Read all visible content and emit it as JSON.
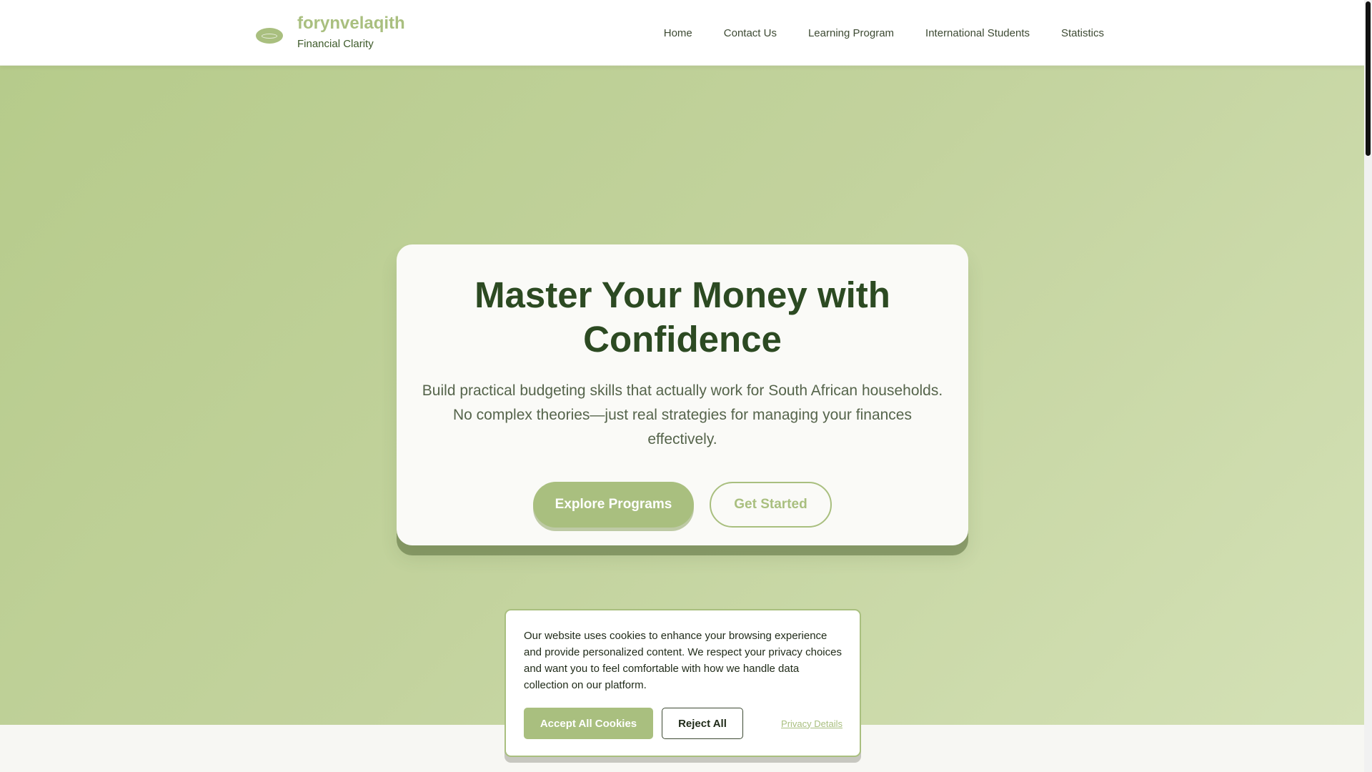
{
  "brand": {
    "name": "forynvelaqith",
    "tagline": "Financial Clarity"
  },
  "nav": {
    "items": [
      {
        "label": "Home"
      },
      {
        "label": "Contact Us"
      },
      {
        "label": "Learning Program"
      },
      {
        "label": "International Students"
      },
      {
        "label": "Statistics"
      }
    ]
  },
  "hero": {
    "title": "Master Your Money with Confidence",
    "subtitle": "Build practical budgeting skills that actually work for South African households. No complex theories—just real strategies for managing your finances effectively.",
    "primary_cta": "Explore Programs",
    "secondary_cta": "Get Started"
  },
  "cookie": {
    "message": "Our website uses cookies to enhance your browsing experience and provide personalized content. We respect your privacy choices and want you to feel comfortable with how we handle data collection on our platform.",
    "accept_label": "Accept All Cookies",
    "reject_label": "Reject All",
    "privacy_label": "Privacy Details"
  },
  "colors": {
    "accent": "#a9bf7f",
    "heading": "#2c4a22",
    "hero_bg": "#c3d39e"
  }
}
